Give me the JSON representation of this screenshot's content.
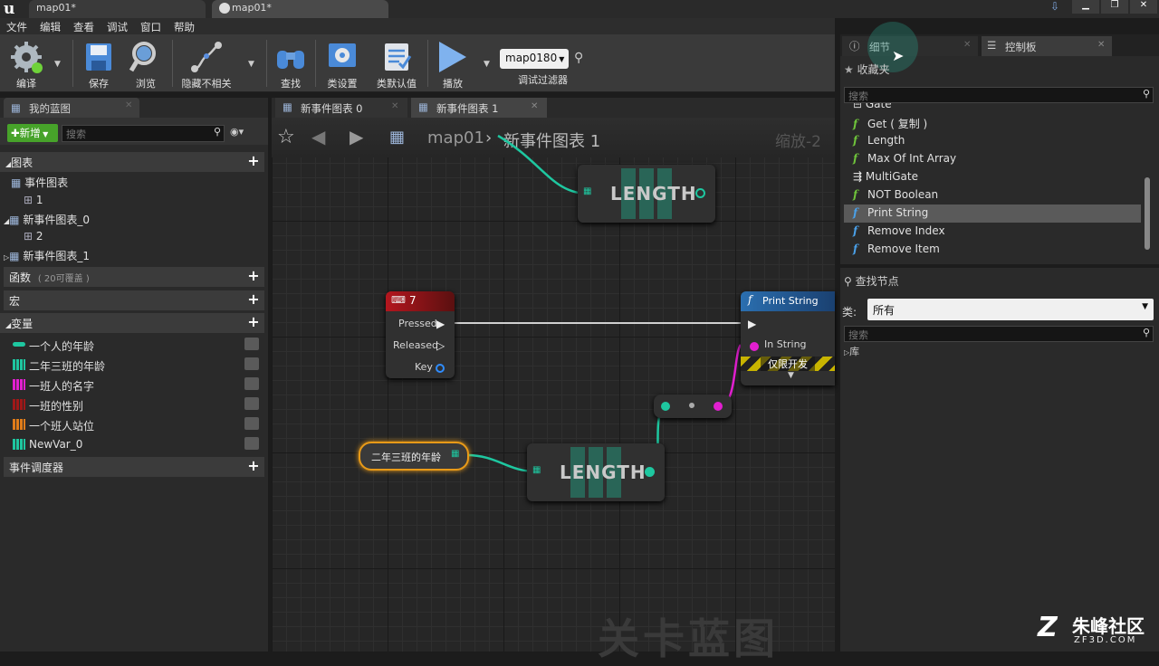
{
  "titlebar": {
    "app_logo": "u",
    "tabs": [
      "map01*",
      "map01*"
    ]
  },
  "menu": [
    "文件",
    "编辑",
    "查看",
    "调试",
    "窗口",
    "帮助"
  ],
  "toolbar": {
    "compile": "编译",
    "save": "保存",
    "browse": "浏览",
    "hide_unrelated": "隐藏不相关",
    "find": "查找",
    "class_settings": "类设置",
    "class_defaults": "类默认值",
    "play": "播放",
    "debug_filter_value": "map0180",
    "debug_filter_label": "调试过滤器"
  },
  "left": {
    "tab": "我的蓝图",
    "new_button": "新增",
    "search_placeholder": "搜索",
    "graphs_header": "图表",
    "tree": [
      "事件图表",
      "1",
      "新事件图表_0",
      "2",
      "新事件图表_1"
    ],
    "functions_header": "函数",
    "functions_note": "( 20可覆盖 )",
    "macros_header": "宏",
    "variables_header": "变量",
    "variables": [
      {
        "name": "一个人的年龄",
        "color": "#1ec7a0"
      },
      {
        "name": "二年三班的年龄",
        "color": "#1ec7a0"
      },
      {
        "name": "一班人的名字",
        "color": "#e21fd0"
      },
      {
        "name": "一班的性别",
        "color": "#a01818"
      },
      {
        "name": "一个班人站位",
        "color": "#e07c1a"
      },
      {
        "name": "NewVar_0",
        "color": "#1ec7a0"
      }
    ],
    "dispatchers_header": "事件调度器"
  },
  "graph": {
    "tabs": [
      "新事件图表 0",
      "新事件图表 1"
    ],
    "breadcrumb_root": "map01",
    "breadcrumb_current": "新事件图表 1",
    "zoom_label": "缩放-2",
    "watermark": "关卡蓝图",
    "length_label": "LENGTH",
    "key_node": {
      "title": "7",
      "pins": [
        "Pressed",
        "Released",
        "Key"
      ]
    },
    "print_node": {
      "title": "Print String",
      "pin": "In String",
      "dev_only": "仅限开发"
    },
    "var_node": "二年三班的年龄"
  },
  "right": {
    "tab_details": "细节",
    "tab_palette": "控制板",
    "favorites": "收藏夹",
    "search_placeholder": "搜索",
    "items": [
      "Gate",
      "Get ( 复制 )",
      "Length",
      "Max Of Int Array",
      "MultiGate",
      "NOT Boolean",
      "Print String",
      "Remove Index",
      "Remove Item"
    ],
    "find_node": "查找节点",
    "class_label": "类:",
    "class_value": "所有",
    "library": "库"
  },
  "brand": {
    "name": "朱峰社区",
    "url": "ZF3D.COM"
  }
}
